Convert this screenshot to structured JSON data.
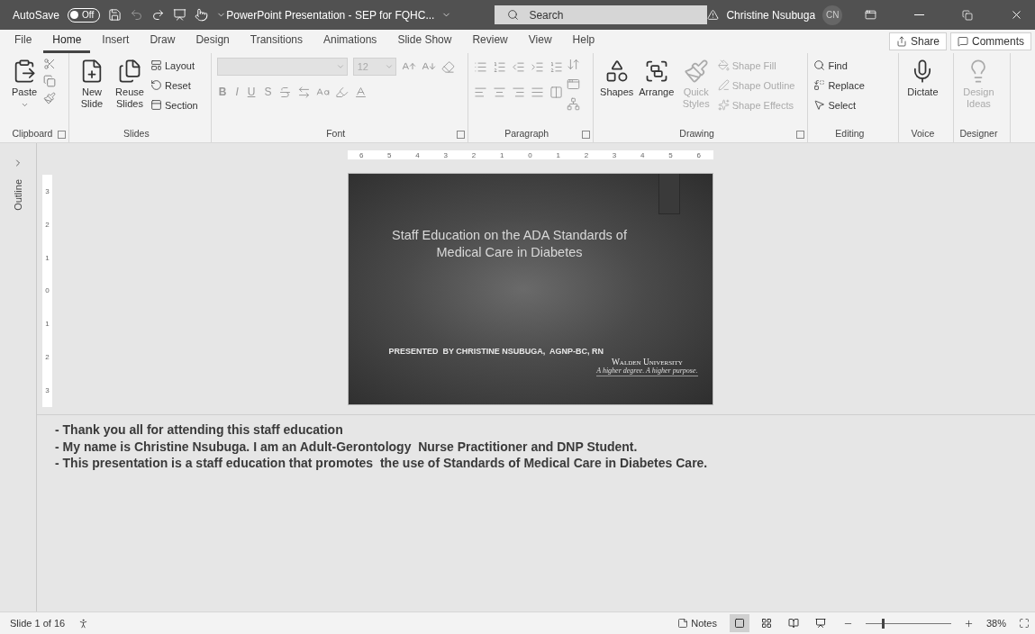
{
  "title_bar": {
    "autosave_label": "AutoSave",
    "autosave_state": "Off",
    "autosave_on": false,
    "document_title": "PowerPoint Presentation - SEP for FQHC...",
    "search_placeholder": "Search",
    "user_name": "Christine Nsubuga",
    "user_initials": "CN"
  },
  "ribbon_tabs": [
    {
      "label": "File",
      "selected": false
    },
    {
      "label": "Home",
      "selected": true
    },
    {
      "label": "Insert",
      "selected": false
    },
    {
      "label": "Draw",
      "selected": false
    },
    {
      "label": "Design",
      "selected": false
    },
    {
      "label": "Transitions",
      "selected": false
    },
    {
      "label": "Animations",
      "selected": false
    },
    {
      "label": "Slide Show",
      "selected": false
    },
    {
      "label": "Review",
      "selected": false
    },
    {
      "label": "View",
      "selected": false
    },
    {
      "label": "Help",
      "selected": false
    }
  ],
  "share_button": "Share",
  "comments_button": "Comments",
  "clipboard": {
    "label": "Clipboard",
    "paste": "Paste"
  },
  "slides_group": {
    "label": "Slides",
    "buttons": [
      "New Slide",
      "Reuse Slides"
    ],
    "options": [
      "Layout",
      "Reset",
      "Section"
    ]
  },
  "font_group": {
    "label": "Font",
    "disabled": true,
    "size_placeholder": "12",
    "format_buttons": [
      "B",
      "I",
      "U",
      "S"
    ]
  },
  "paragraph_group": {
    "label": "Paragraph",
    "disabled": true
  },
  "drawing_group": {
    "label": "Drawing",
    "buttons": [
      {
        "label": "Shapes",
        "disabled": false
      },
      {
        "label": "Arrange",
        "disabled": false
      },
      {
        "label": "Quick Styles",
        "disabled": true
      }
    ],
    "options": [
      {
        "label": "Shape Fill",
        "disabled": true
      },
      {
        "label": "Shape Outline",
        "disabled": true
      },
      {
        "label": "Shape Effects",
        "disabled": true
      }
    ]
  },
  "editing_group": {
    "label": "Editing",
    "options": [
      "Find",
      "Replace",
      "Select"
    ]
  },
  "voice_group": {
    "label": "Voice",
    "button": "Dictate"
  },
  "designer_group": {
    "label": "Designer",
    "button": "Design Ideas",
    "disabled": true
  },
  "outline_pane": {
    "label": "Outline"
  },
  "horizontal_ruler": [
    "6",
    "5",
    "4",
    "3",
    "2",
    "1",
    "0",
    "1",
    "2",
    "3",
    "4",
    "5",
    "6"
  ],
  "vertical_ruler": [
    "3",
    "2",
    "1",
    "0",
    "1",
    "2",
    "3"
  ],
  "slide": {
    "title": "Staff Education on the ADA Standards of Medical Care in Diabetes",
    "presenter": "PRESENTED  BY CHRISTINE NSUBUGA,  AGNP-BC, RN",
    "logo_name": "Walden University",
    "logo_tagline": "A higher degree. A higher purpose."
  },
  "notes": [
    "- Thank you all for attending this staff education",
    "- My name is Christine Nsubuga. I am an Adult-Gerontology  Nurse Practitioner and DNP Student.",
    "- This presentation is a staff education that promotes  the use of Standards of Medical Care in Diabetes Care."
  ],
  "status_bar": {
    "slide_counter": "Slide 1 of 16",
    "notes_button": "Notes",
    "views": [
      {
        "selected": true
      },
      {
        "selected": false
      },
      {
        "selected": false
      },
      {
        "selected": false
      }
    ],
    "zoom": {
      "level": 0.2,
      "reading": "38%"
    }
  }
}
